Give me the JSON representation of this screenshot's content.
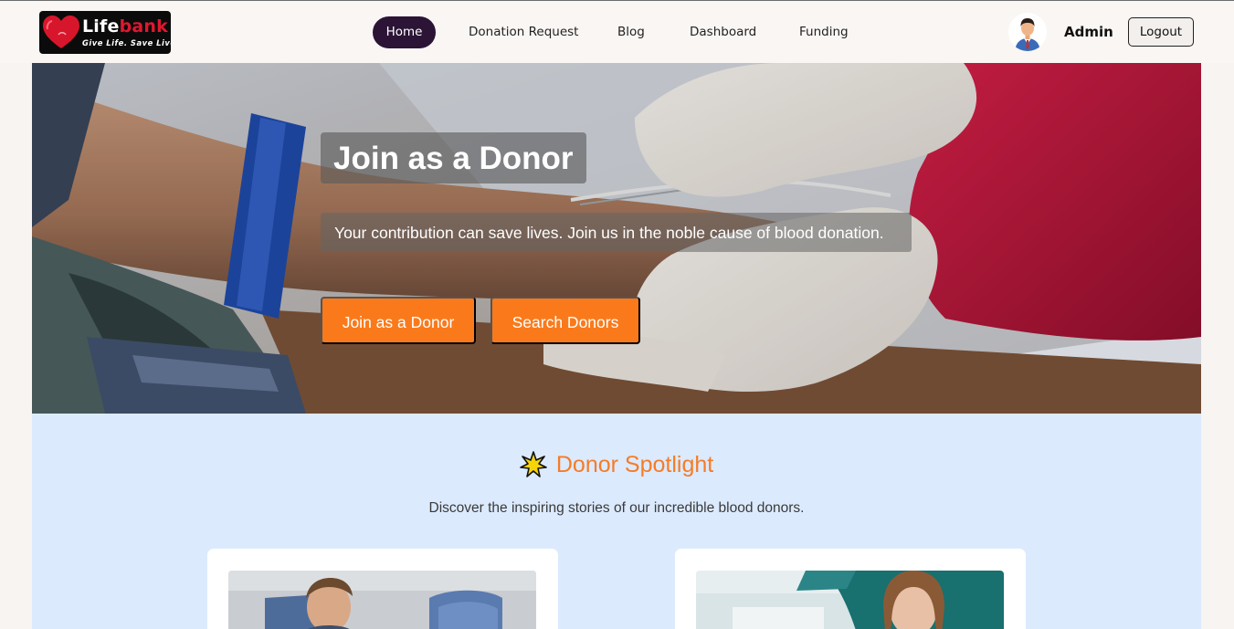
{
  "brand": {
    "name_part1": "Life",
    "name_part2": "bank",
    "tagline": "Give Life. Save Lives"
  },
  "nav": {
    "items": [
      {
        "label": "Home",
        "active": true
      },
      {
        "label": "Donation Request",
        "active": false
      },
      {
        "label": "Blog",
        "active": false
      },
      {
        "label": "Dashboard",
        "active": false
      },
      {
        "label": "Funding",
        "active": false
      }
    ]
  },
  "user": {
    "name": "Admin",
    "logout_label": "Logout",
    "avatar_icon": "user-avatar-icon"
  },
  "hero": {
    "title": "Join as a Donor",
    "subtitle": "Your contribution can save lives. Join us in the noble cause of blood donation.",
    "primary_button": "Join as a Donor",
    "secondary_button": "Search Donors"
  },
  "spotlight": {
    "icon": "star-burst-icon",
    "title": "Donor Spotlight",
    "subtitle": "Discover the inspiring stories of our incredible blood donors."
  },
  "colors": {
    "accent": "#fa7a1b",
    "nav_active": "#2b1435",
    "spotlight_bg": "#dceafe",
    "brand_red": "#e0172f"
  }
}
